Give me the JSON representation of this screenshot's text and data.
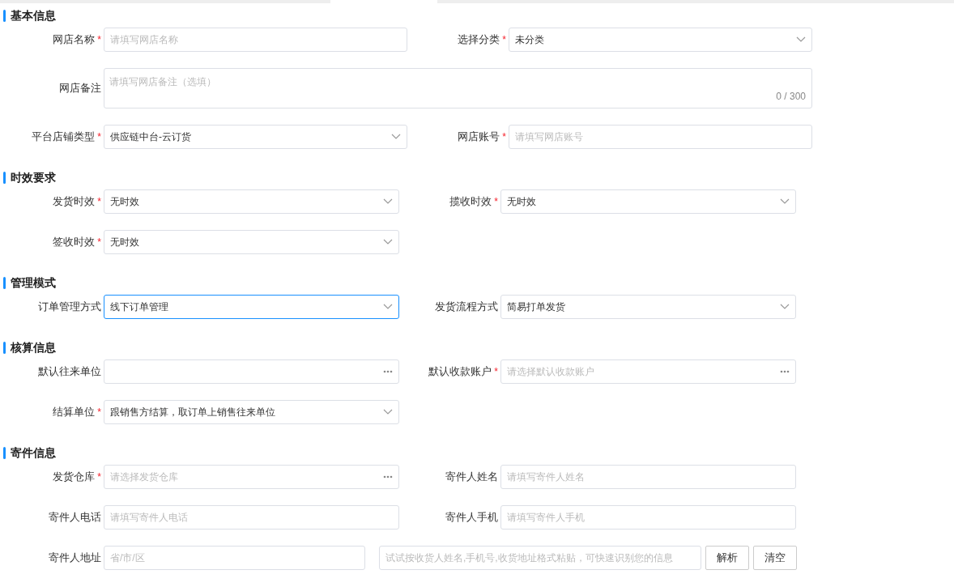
{
  "sections": [
    {
      "title": "基本信息",
      "rows": [
        {
          "fields": [
            {
              "kind": "input",
              "label": "网店名称",
              "mark": "*",
              "placeholder": "请填写网店名称"
            },
            {
              "kind": "select",
              "label": "选择分类",
              "mark": "*",
              "value": "未分类",
              "focused": false
            }
          ]
        },
        {
          "fields": [
            {
              "kind": "textarea",
              "label": "网店备注",
              "placeholder": "请填写网店备注（选填）",
              "counter": "0 / 300"
            }
          ]
        },
        {
          "fields": [
            {
              "kind": "select",
              "label": "平台店铺类型",
              "mark": "*",
              "value": "供应链中台-云订货",
              "focused": false
            },
            {
              "kind": "input",
              "label": "网店账号",
              "mark": "*",
              "placeholder": "请填写网店账号"
            }
          ]
        }
      ]
    },
    {
      "title": "时效要求",
      "rows": [
        {
          "fields": [
            {
              "kind": "select",
              "label": "发货时效",
              "mark": "*",
              "value": "无时效",
              "focused": false
            },
            {
              "kind": "select",
              "label": "揽收时效",
              "mark": "*",
              "value": "无时效",
              "focused": false
            }
          ]
        },
        {
          "fields": [
            {
              "kind": "select",
              "label": "签收时效",
              "mark": "*",
              "value": "无时效",
              "focused": false
            }
          ]
        }
      ]
    },
    {
      "title": "管理模式",
      "rows": [
        {
          "fields": [
            {
              "kind": "select",
              "label": "订单管理方式",
              "value": "线下订单管理",
              "focused": true
            },
            {
              "kind": "select",
              "label": "发货流程方式",
              "value": "简易打单发货",
              "focused": false
            }
          ]
        }
      ]
    },
    {
      "title": "核算信息",
      "rows": [
        {
          "fields": [
            {
              "kind": "picker",
              "label": "默认往来单位"
            },
            {
              "kind": "picker",
              "label": "默认收款账户",
              "mark": "*",
              "placeholder": "请选择默认收款账户"
            }
          ]
        },
        {
          "fields": [
            {
              "kind": "select",
              "label": "结算单位",
              "mark": "*",
              "value": "跟销售方结算，取订单上销售往来单位",
              "focused": false
            }
          ]
        }
      ]
    },
    {
      "title": "寄件信息",
      "rows": [
        {
          "fields": [
            {
              "kind": "picker",
              "label": "发货仓库",
              "mark": "*",
              "placeholder": "请选择发货仓库"
            },
            {
              "kind": "input",
              "label": "寄件人姓名",
              "placeholder": "请填写寄件人姓名"
            }
          ]
        },
        {
          "fields": [
            {
              "kind": "input",
              "label": "寄件人电话",
              "placeholder": "请填写寄件人电话"
            },
            {
              "kind": "input",
              "label": "寄件人手机",
              "placeholder": "请填写寄件人手机"
            }
          ]
        },
        {
          "fields": [
            {
              "kind": "address",
              "label": "寄件人地址",
              "region_placeholder": "省/市/区",
              "paste_placeholder": "试试按收货人姓名,手机号,收货地址格式粘贴，可快速识别您的信息",
              "buttons": [
                "解析",
                "清空"
              ]
            }
          ]
        }
      ]
    }
  ]
}
